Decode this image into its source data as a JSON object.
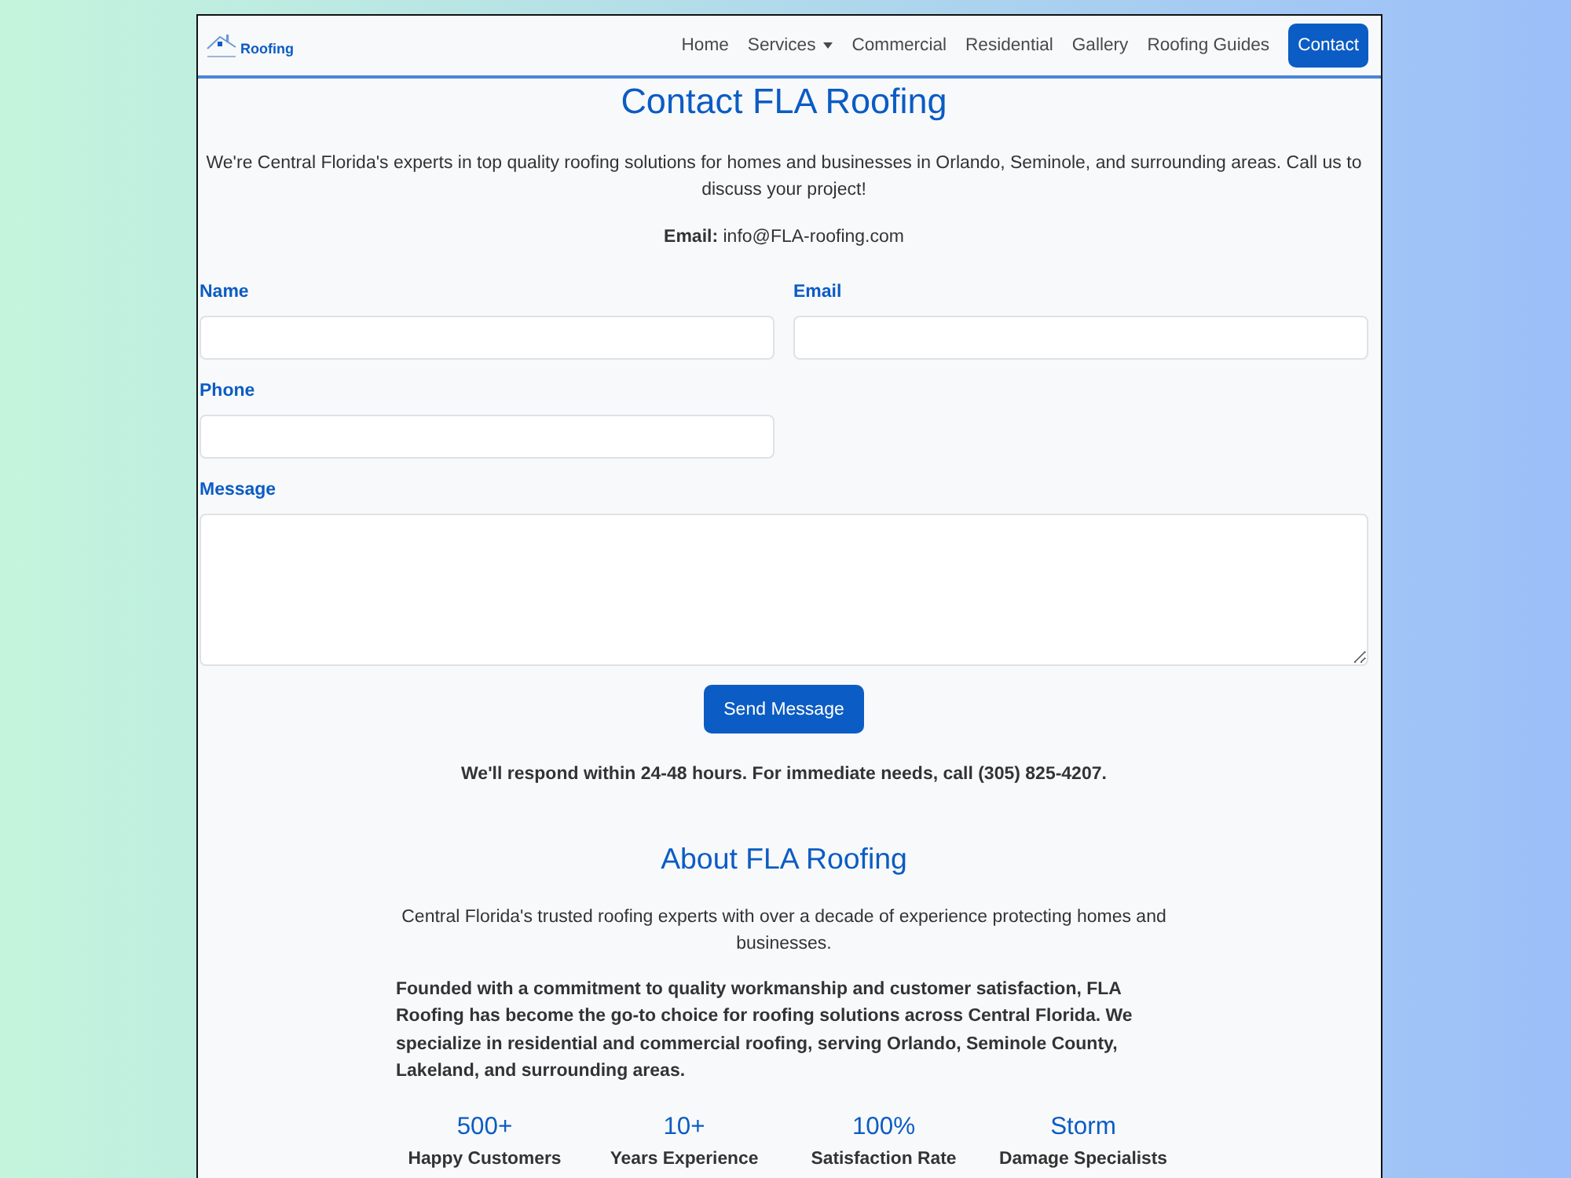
{
  "navbar": {
    "logo": {
      "text": "Roofing"
    },
    "links": [
      {
        "label": "Home",
        "dropdown": false,
        "selected": false
      },
      {
        "label": "Services",
        "dropdown": true,
        "selected": false
      },
      {
        "label": "Commercial",
        "dropdown": false,
        "selected": false
      },
      {
        "label": "Residential",
        "dropdown": false,
        "selected": false
      },
      {
        "label": "Gallery",
        "dropdown": false,
        "selected": false
      },
      {
        "label": "Roofing Guides",
        "dropdown": false,
        "selected": false
      },
      {
        "label": "Contact",
        "dropdown": false,
        "selected": true
      }
    ]
  },
  "contact": {
    "title": "Contact FLA Roofing",
    "intro": "We're Central Florida's experts in top quality roofing solutions for homes and businesses in Orlando, Seminole, and surrounding areas. Call us to discuss your project!",
    "email": "**Email:** info@FLA-roofing.com",
    "form": {
      "fields": [
        {
          "label": "Name",
          "kind": "input"
        },
        {
          "label": "Email",
          "kind": "input"
        },
        {
          "label": "Phone",
          "kind": "input"
        },
        {
          "label": "Message",
          "kind": "textarea"
        }
      ],
      "submit": "Send Message"
    },
    "note": "We'll respond within 24-48 hours. For immediate needs, call (305) 825-4207."
  },
  "about": {
    "title": "About FLA Roofing",
    "intro": "Central Florida's trusted roofing experts with over a decade of experience protecting homes and businesses.",
    "body": "Founded with a commitment to quality workmanship and customer satisfaction, FLA Roofing has become the go-to choice for roofing solutions across Central Florida. We specialize in residential and commercial roofing, serving Orlando, Seminole County, Lakeland, and surrounding areas.",
    "stats": [
      {
        "value": "500+",
        "label": "Happy Customers"
      },
      {
        "value": "10+",
        "label": "Years Experience"
      },
      {
        "value": "100%",
        "label": "Satisfaction Rate"
      },
      {
        "value": "Storm",
        "label": "Damage Specialists"
      }
    ]
  }
}
